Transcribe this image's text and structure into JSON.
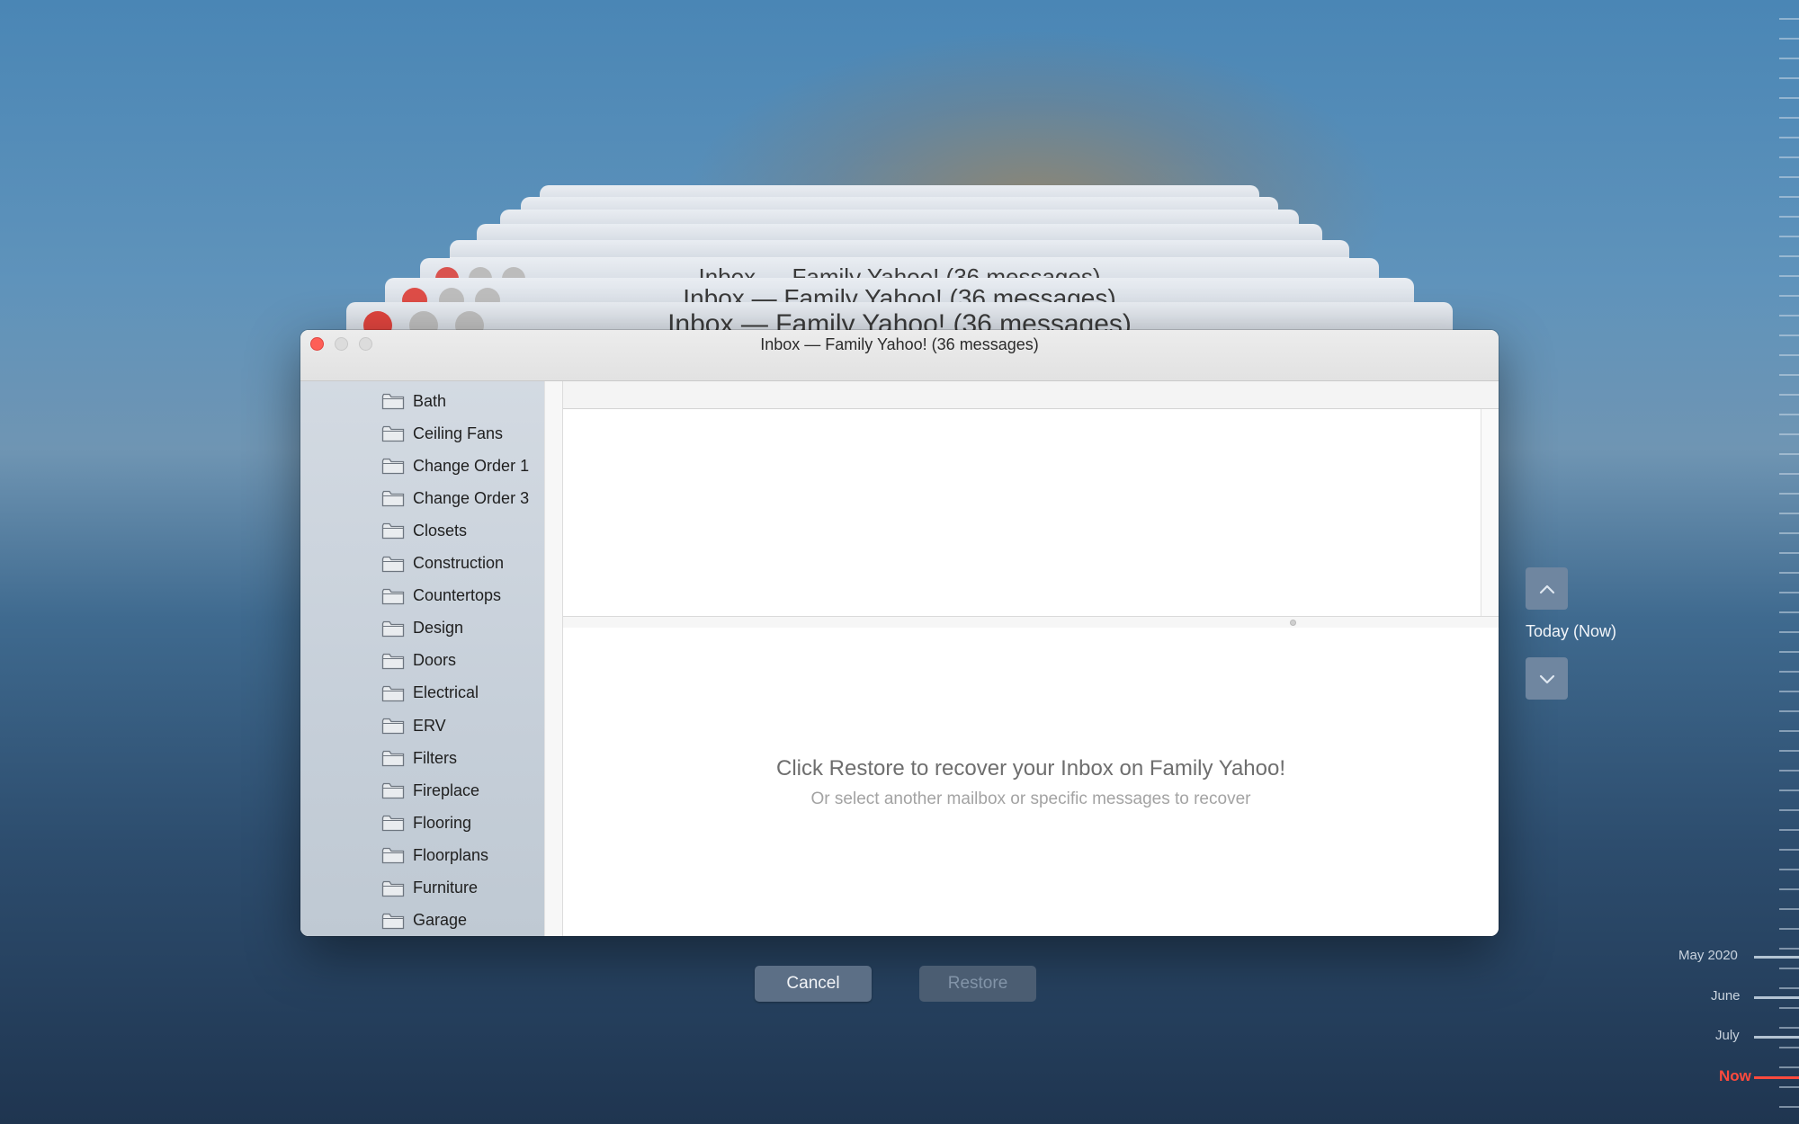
{
  "background_windows": [
    {
      "title": "Inbox — Family Yahoo! (36 messages)"
    },
    {
      "title": "Inbox — Family Yahoo! (36 messages)"
    },
    {
      "title": "Inbox — Family Yahoo! (36 messages)"
    }
  ],
  "window": {
    "title": "Inbox — Family Yahoo! (36 messages)"
  },
  "sidebar": {
    "folders": [
      {
        "label": "Bath"
      },
      {
        "label": "Ceiling Fans"
      },
      {
        "label": "Change Order 1"
      },
      {
        "label": "Change Order 3"
      },
      {
        "label": "Closets"
      },
      {
        "label": "Construction"
      },
      {
        "label": "Countertops"
      },
      {
        "label": "Design"
      },
      {
        "label": "Doors"
      },
      {
        "label": "Electrical"
      },
      {
        "label": "ERV"
      },
      {
        "label": "Filters"
      },
      {
        "label": "Fireplace"
      },
      {
        "label": "Flooring"
      },
      {
        "label": "Floorplans"
      },
      {
        "label": "Furniture"
      },
      {
        "label": "Garage"
      }
    ]
  },
  "message_view": {
    "headline": "Click Restore to recover your Inbox on Family Yahoo!",
    "subline": "Or select another mailbox or specific messages to recover"
  },
  "buttons": {
    "cancel_label": "Cancel",
    "restore_label": "Restore"
  },
  "time_machine": {
    "current_label": "Today (Now)",
    "timeline": [
      {
        "label": "May 2020"
      },
      {
        "label": "June"
      },
      {
        "label": "July"
      },
      {
        "label": "Now"
      }
    ]
  },
  "colors": {
    "close": "#fe5f57",
    "now_marker": "#ff4a3d",
    "button": "#5c6f86"
  }
}
